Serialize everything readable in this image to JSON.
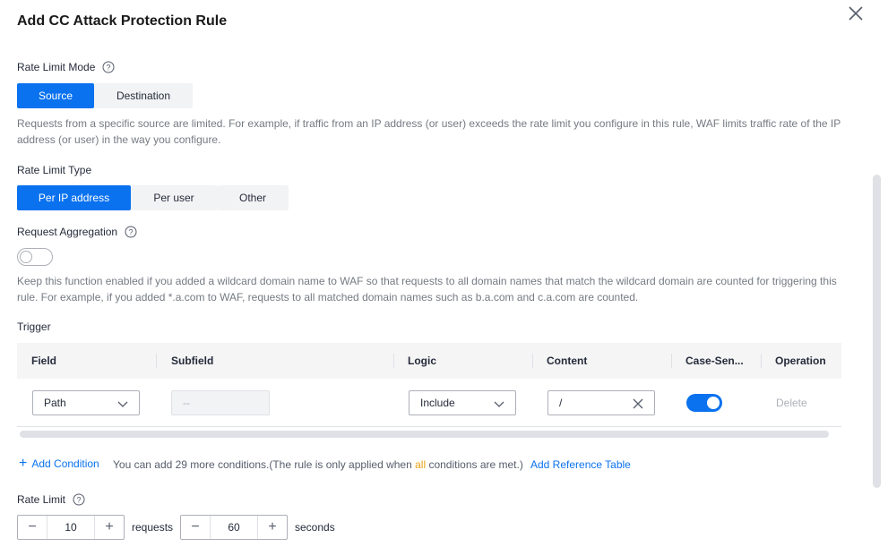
{
  "dialog": {
    "title": "Add CC Attack Protection Rule"
  },
  "rate_limit_mode": {
    "label": "Rate Limit Mode",
    "options": [
      "Source",
      "Destination"
    ],
    "selected": "Source",
    "description": "Requests from a specific source are limited. For example, if traffic from an IP address (or user) exceeds the rate limit you configure in this rule, WAF limits traffic rate of the IP address (or user) in the way you configure."
  },
  "rate_limit_type": {
    "label": "Rate Limit Type",
    "options": [
      "Per IP address",
      "Per user",
      "Other"
    ],
    "selected": "Per IP address"
  },
  "request_aggregation": {
    "label": "Request Aggregation",
    "enabled": false,
    "description": "Keep this function enabled if you added a wildcard domain name to WAF so that requests to all domain names that match the wildcard domain are counted for triggering this rule. For example, if you added *.a.com to WAF, requests to all matched domain names such as b.a.com and c.a.com are counted."
  },
  "trigger": {
    "label": "Trigger",
    "columns": [
      "Field",
      "Subfield",
      "Logic",
      "Content",
      "Case-Sen...",
      "Operation"
    ],
    "rows": [
      {
        "field": "Path",
        "subfield": "--",
        "logic": "Include",
        "content": "/",
        "case_sensitive": true,
        "operation": "Delete"
      }
    ],
    "add_condition": "Add Condition",
    "note_prefix": "You can add 29 more conditions.(The rule is only applied when ",
    "note_highlight": "all",
    "note_suffix": " conditions are met.)",
    "reference_table": "Add Reference Table"
  },
  "rate_limit": {
    "label": "Rate Limit",
    "requests_value": "10",
    "requests_unit": "requests",
    "seconds_value": "60",
    "seconds_unit": "seconds"
  },
  "icons": {
    "close": "close-icon",
    "help": "help-icon",
    "chevron": "chevron-down-icon",
    "clear": "clear-icon",
    "plus": "plus-icon",
    "minus": "minus-icon"
  },
  "colors": {
    "accent": "#0a72ef",
    "highlight": "#e8a117"
  }
}
